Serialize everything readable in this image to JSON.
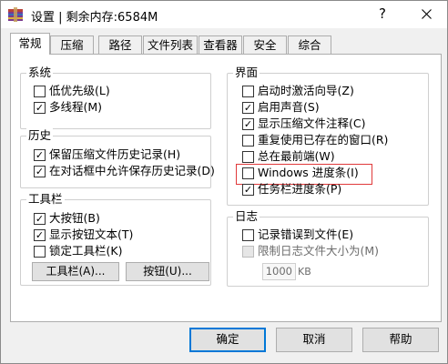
{
  "window": {
    "title": "设置 | 剩余内存:6584M",
    "help_glyph": "?",
    "close_glyph": "X"
  },
  "tabs": [
    {
      "label": "常规",
      "active": true
    },
    {
      "label": "压缩"
    },
    {
      "label": "路径"
    },
    {
      "label": "文件列表"
    },
    {
      "label": "查看器"
    },
    {
      "label": "安全"
    },
    {
      "label": "综合"
    }
  ],
  "system": {
    "title": "系统",
    "items": [
      {
        "label": "低优先级(L)",
        "checked": false
      },
      {
        "label": "多线程(M)",
        "checked": true
      }
    ]
  },
  "history": {
    "title": "历史",
    "items": [
      {
        "label": "保留压缩文件历史记录(H)",
        "checked": true
      },
      {
        "label": "在对话框中允许保存历史记录(D)",
        "checked": true
      }
    ]
  },
  "toolbar": {
    "title": "工具栏",
    "items": [
      {
        "label": "大按钮(B)",
        "checked": true
      },
      {
        "label": "显示按钮文本(T)",
        "checked": true
      },
      {
        "label": "锁定工具栏(K)",
        "checked": false
      }
    ],
    "toolbar_button": "工具栏(A)...",
    "buttons_button": "按钮(U)..."
  },
  "interface": {
    "title": "界面",
    "items": [
      {
        "label": "启动时激活向导(Z)",
        "checked": false
      },
      {
        "label": "启用声音(S)",
        "checked": true
      },
      {
        "label": "显示压缩文件注释(C)",
        "checked": true
      },
      {
        "label": "重复使用已存在的窗口(R)",
        "checked": false
      },
      {
        "label": "总在最前端(W)",
        "checked": false
      },
      {
        "label": "Windows 进度条(I)",
        "checked": false
      },
      {
        "label": "任务栏进度条(P)",
        "checked": true
      }
    ]
  },
  "log": {
    "title": "日志",
    "items": [
      {
        "label": "记录错误到文件(E)",
        "checked": false
      },
      {
        "label": "限制日志文件大小为(M)",
        "checked": false,
        "disabled": true
      }
    ],
    "size_value": "1000",
    "size_unit": "KB"
  },
  "buttons": {
    "ok": "确定",
    "cancel": "取消",
    "help": "帮助"
  },
  "colors": {
    "highlight": "#e0393a",
    "accent": "#0078d7"
  }
}
